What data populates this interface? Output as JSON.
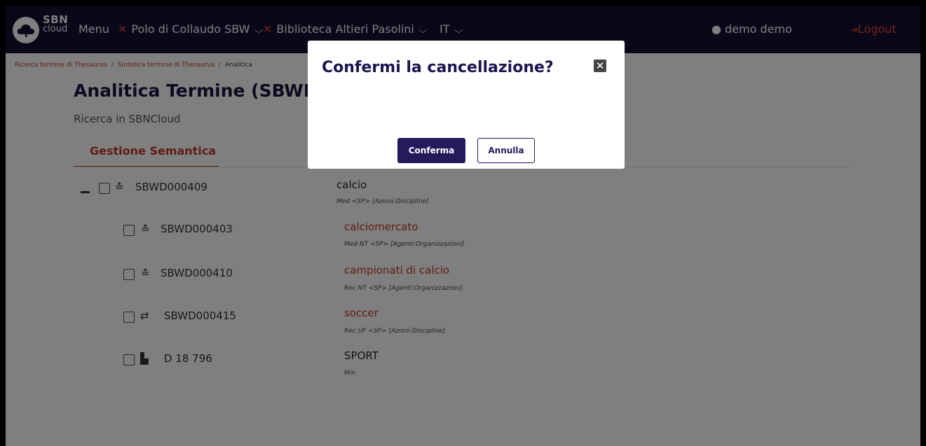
{
  "navbar": {
    "logo_sbn": "SBN",
    "logo_cloud": "cloud",
    "menu_label": "Menu",
    "polo_label": "Polo di Collaudo SBW",
    "biblioteca_label": "Biblioteca Altieri Pasolini",
    "language_label": "IT",
    "user_label": "demo demo",
    "logout_label": "Logout",
    "colors": {
      "background": "#140f33",
      "accent": "#e8472e"
    }
  },
  "breadcrumb": {
    "items": [
      "Ricerca termine di Thesaurus",
      "Sintetica termine di Thesaurus",
      "Analitica"
    ]
  },
  "page": {
    "title": "Analitica Termine (SBWD0",
    "subtitle": "Ricerca in SBNCloud",
    "tab_label": "Gestione Semantica"
  },
  "tree": {
    "root": {
      "code": "SBWD000409",
      "icon": "thesaurus-icon",
      "term": "calcio",
      "meta": "Med <SP> [Azioni:Discipline]"
    },
    "children": [
      {
        "code": "SBWD000403",
        "icon": "thesaurus-icon",
        "term": "calciomercato",
        "meta": "Med NT <SP> [Agenti:Organizzazioni]",
        "color": "#c0392b"
      },
      {
        "code": "SBWD000410",
        "icon": "thesaurus-icon",
        "term": "campionati di calcio",
        "meta": "Rec NT <SP> [Agenti:Organizzazioni]",
        "color": "#c0392b"
      },
      {
        "code": "SBWD000415",
        "icon": "exchange-icon",
        "term": "soccer",
        "meta": "Rec UF <SP> [Azioni:Discipline]",
        "color": "#c0392b"
      },
      {
        "code": "D 18 796",
        "icon": "classification-icon",
        "term": "SPORT",
        "meta": "Min",
        "color": "#222222"
      }
    ]
  },
  "modal": {
    "title": "Confermi la cancellazione?",
    "confirm_label": "Conferma",
    "cancel_label": "Annulla",
    "close_icon": "close-icon"
  }
}
